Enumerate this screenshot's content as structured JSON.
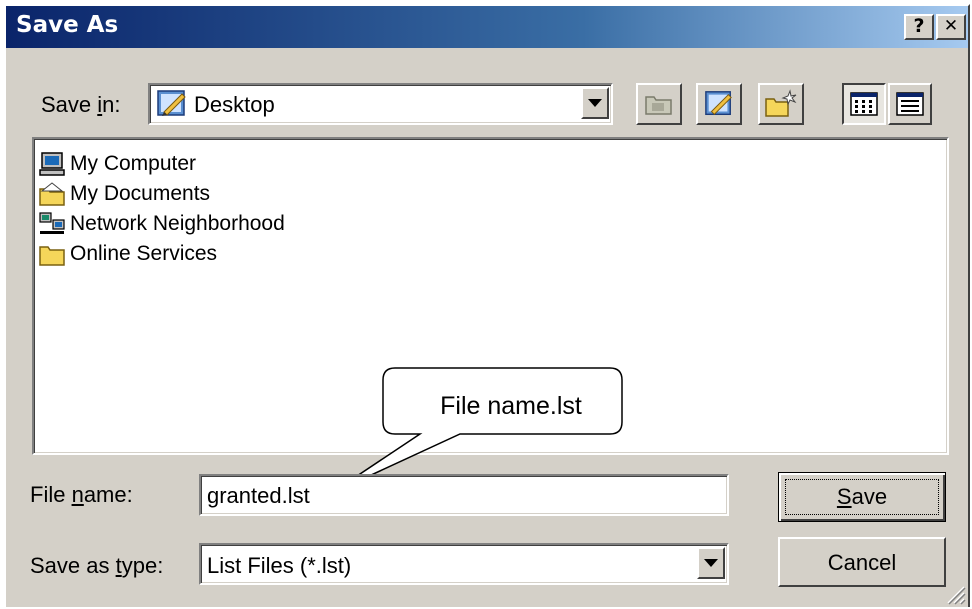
{
  "dialog": {
    "title": "Save As",
    "help_button": "?",
    "close_button": "✕"
  },
  "save_in": {
    "label": "Save ",
    "label_hotkey": "i",
    "label_rest": "n:",
    "value": "Desktop"
  },
  "list": {
    "items": [
      {
        "label": "My Computer",
        "icon": "computer-icon"
      },
      {
        "label": "My Documents",
        "icon": "documents-folder-icon"
      },
      {
        "label": "Network Neighborhood",
        "icon": "network-icon"
      },
      {
        "label": "Online Services",
        "icon": "folder-icon"
      }
    ]
  },
  "callout": {
    "text": "File name.lst"
  },
  "file_name": {
    "label_pre": "File ",
    "label_hotkey": "n",
    "label_rest": "ame:",
    "value": "granted.lst"
  },
  "save_as_type": {
    "label_pre": "Save as ",
    "label_hotkey": "t",
    "label_rest": "ype:",
    "value": "List Files (*.lst)"
  },
  "buttons": {
    "save_hotkey": "S",
    "save_rest": "ave",
    "cancel": "Cancel"
  },
  "colors": {
    "title_gradient_start": "#0a246a",
    "title_gradient_end": "#a6caf0",
    "dialog_face": "#d4d0c8"
  }
}
